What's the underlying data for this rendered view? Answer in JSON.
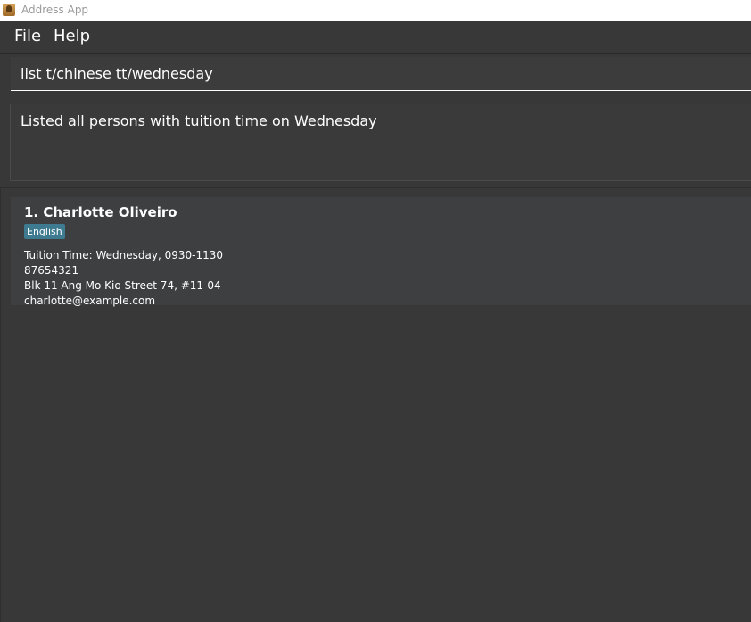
{
  "window": {
    "title": "Address App"
  },
  "menu": {
    "file_label": "File",
    "help_label": "Help"
  },
  "command_box": {
    "value": "list t/chinese tt/wednesday"
  },
  "result_display": {
    "text": "Listed all persons with tuition time on Wednesday"
  },
  "persons": [
    {
      "index_name": "1. Charlotte Oliveiro",
      "tags": [
        "English"
      ],
      "tuition_time": "Tuition Time: Wednesday, 0930-1130",
      "phone": "87654321",
      "address": "Blk 11 Ang Mo Kio Street 74, #11-04",
      "email": "charlotte@example.com"
    }
  ],
  "colors": {
    "background": "#383838",
    "card": "#3e3f41",
    "tag": "#3e7b91",
    "text": "#ffffff"
  },
  "icons": {
    "app_icon": "address-book-icon"
  }
}
